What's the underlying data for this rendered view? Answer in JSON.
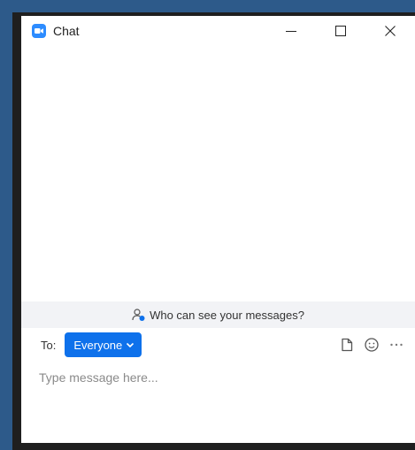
{
  "window": {
    "title": "Chat",
    "app_icon": "zoom-camera-icon",
    "controls": [
      "minimize-icon",
      "maximize-icon",
      "close-icon"
    ]
  },
  "visibility": {
    "text": "Who can see your messages?",
    "icon": "person-info-icon"
  },
  "compose": {
    "to_label": "To:",
    "recipient": "Everyone",
    "tools": [
      "file-icon",
      "emoji-icon",
      "more-icon"
    ],
    "placeholder": "Type message here..."
  },
  "colors": {
    "accent": "#0e71eb",
    "app_icon": "#2d8cff",
    "desktop": "#2d5a8a"
  }
}
